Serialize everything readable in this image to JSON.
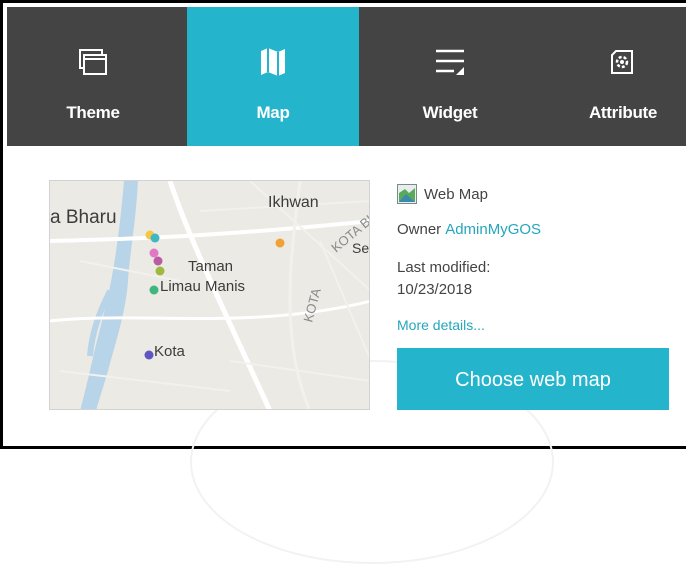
{
  "tabs": [
    {
      "label": "Theme",
      "icon": "theme-icon",
      "active": false
    },
    {
      "label": "Map",
      "icon": "map-icon",
      "active": true
    },
    {
      "label": "Widget",
      "icon": "widget-icon",
      "active": false
    },
    {
      "label": "Attribute",
      "icon": "attribute-icon",
      "active": false
    }
  ],
  "map_item": {
    "type": "Web Map",
    "owner_label": "Owner",
    "owner_name": "AdminMyGOS",
    "modified_label": "Last modified:",
    "modified_date": "10/23/2018",
    "more_details": "More details...",
    "choose_button": "Choose web map"
  },
  "thumbnail": {
    "labels": {
      "bharu": "a Bharu",
      "ikhwan": "Ikhwan",
      "taman": "Taman",
      "limau": "Limau Manis",
      "kota": "Kota",
      "kota_bharu_road": "KOTA BHARU",
      "kota_road": "KOTA",
      "se": "Se"
    }
  },
  "colors": {
    "accent": "#24b5cc",
    "tabbar": "#444444",
    "link": "#24a6bd",
    "text": "#444444"
  }
}
